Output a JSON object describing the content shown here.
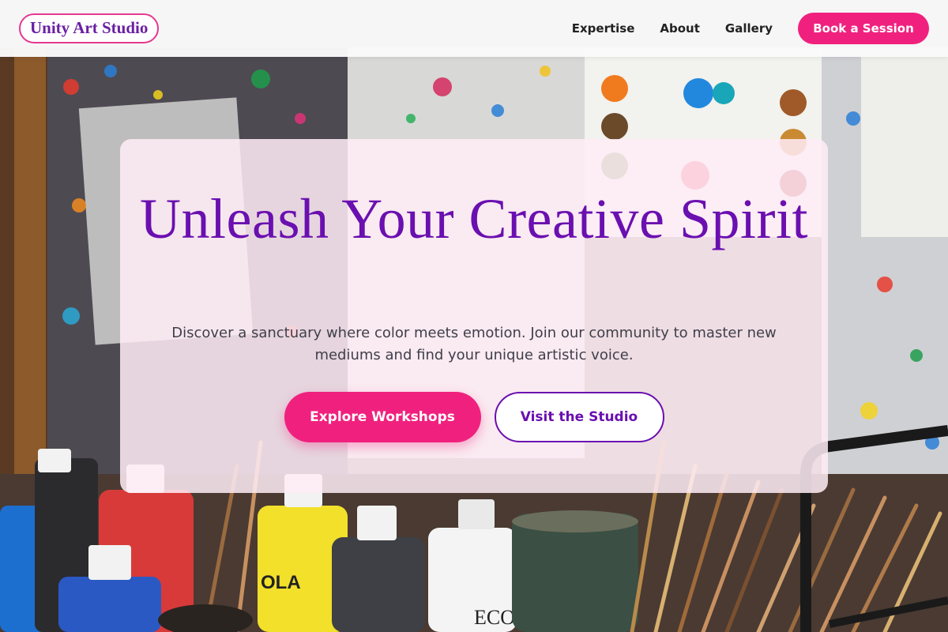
{
  "brand": {
    "name": "Unity Art Studio"
  },
  "nav": {
    "links": [
      {
        "label": "Expertise"
      },
      {
        "label": "About"
      },
      {
        "label": "Gallery"
      }
    ],
    "cta_label": "Book a Session"
  },
  "hero": {
    "title": "Unleash Your Creative Spirit",
    "subtitle": "Discover a sanctuary where color meets emotion. Join our community to master new mediums and find your unique artistic voice.",
    "primary_button": "Explore Workshops",
    "secondary_button": "Visit the Studio"
  },
  "colors": {
    "accent_pink": "#f0217e",
    "brand_purple": "#6a0fb0"
  },
  "background": {
    "description_icon": "art-studio-photo",
    "paint_labels": [
      "OLA",
      "ECO"
    ]
  }
}
